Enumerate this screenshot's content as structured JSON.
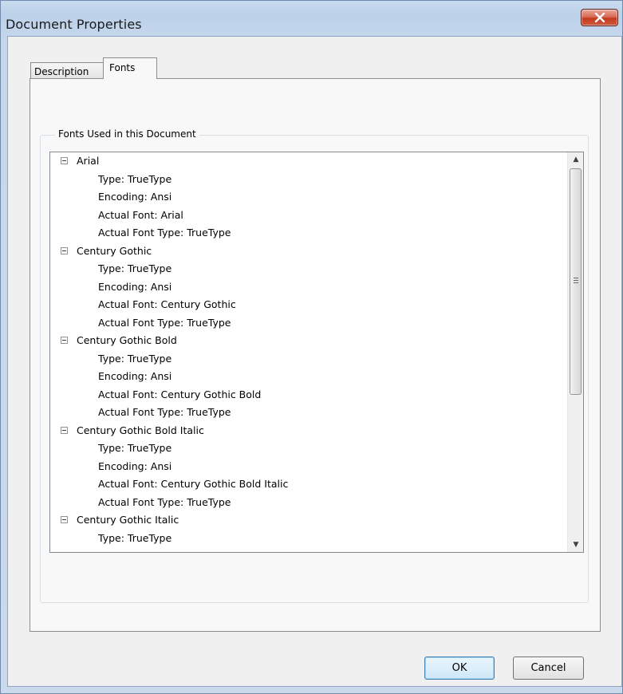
{
  "window": {
    "title": "Document Properties"
  },
  "tabs": [
    {
      "label": "Description",
      "active": false
    },
    {
      "label": "Fonts",
      "active": true
    }
  ],
  "fonts_group": {
    "label": "Fonts Used in this Document",
    "fonts": [
      {
        "name": "Arial",
        "details": [
          "Type: TrueType",
          "Encoding: Ansi",
          "Actual Font: Arial",
          "Actual Font Type: TrueType"
        ]
      },
      {
        "name": "Century Gothic",
        "details": [
          "Type: TrueType",
          "Encoding: Ansi",
          "Actual Font: Century Gothic",
          "Actual Font Type: TrueType"
        ]
      },
      {
        "name": "Century Gothic Bold",
        "details": [
          "Type: TrueType",
          "Encoding: Ansi",
          "Actual Font: Century Gothic Bold",
          "Actual Font Type: TrueType"
        ]
      },
      {
        "name": "Century Gothic Bold Italic",
        "details": [
          "Type: TrueType",
          "Encoding: Ansi",
          "Actual Font: Century Gothic Bold Italic",
          "Actual Font Type: TrueType"
        ]
      },
      {
        "name": "Century Gothic Italic",
        "details": [
          "Type: TrueType"
        ]
      }
    ]
  },
  "buttons": {
    "ok": "OK",
    "cancel": "Cancel"
  },
  "icons": {
    "close": "close-icon",
    "expander": "minus-box-icon",
    "scroll_up": "scroll-up-arrow-icon",
    "scroll_down": "scroll-down-arrow-icon"
  }
}
